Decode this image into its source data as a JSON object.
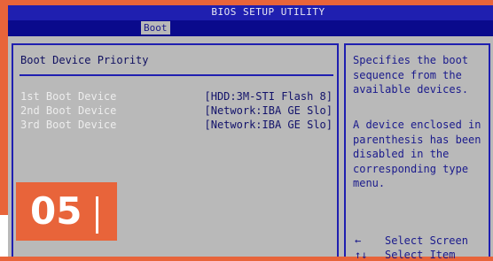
{
  "window": {
    "title": "BIOS SETUP UTILITY"
  },
  "tabs": [
    {
      "label": "Boot",
      "active": true
    }
  ],
  "section": {
    "title": "Boot Device Priority"
  },
  "boot_devices": [
    {
      "label": "1st Boot Device",
      "value": "[HDD:3M-STI Flash 8]"
    },
    {
      "label": "2nd Boot Device",
      "value": "[Network:IBA GE Slo]"
    },
    {
      "label": "3rd Boot Device",
      "value": "[Network:IBA GE Slo]"
    }
  ],
  "help": {
    "text1": "Specifies the boot\nsequence from the\navailable devices.",
    "text2": "A device enclosed in\nparenthesis has been\ndisabled in the\ncorresponding type\nmenu."
  },
  "keys": [
    {
      "key": "←",
      "action": "Select Screen"
    },
    {
      "key": "↑↓",
      "action": "Select Item"
    }
  ],
  "badge": {
    "number": "05"
  },
  "colors": {
    "background": "#1f1fb0",
    "panel": "#b9b9b9",
    "accent": "#e8643a"
  }
}
